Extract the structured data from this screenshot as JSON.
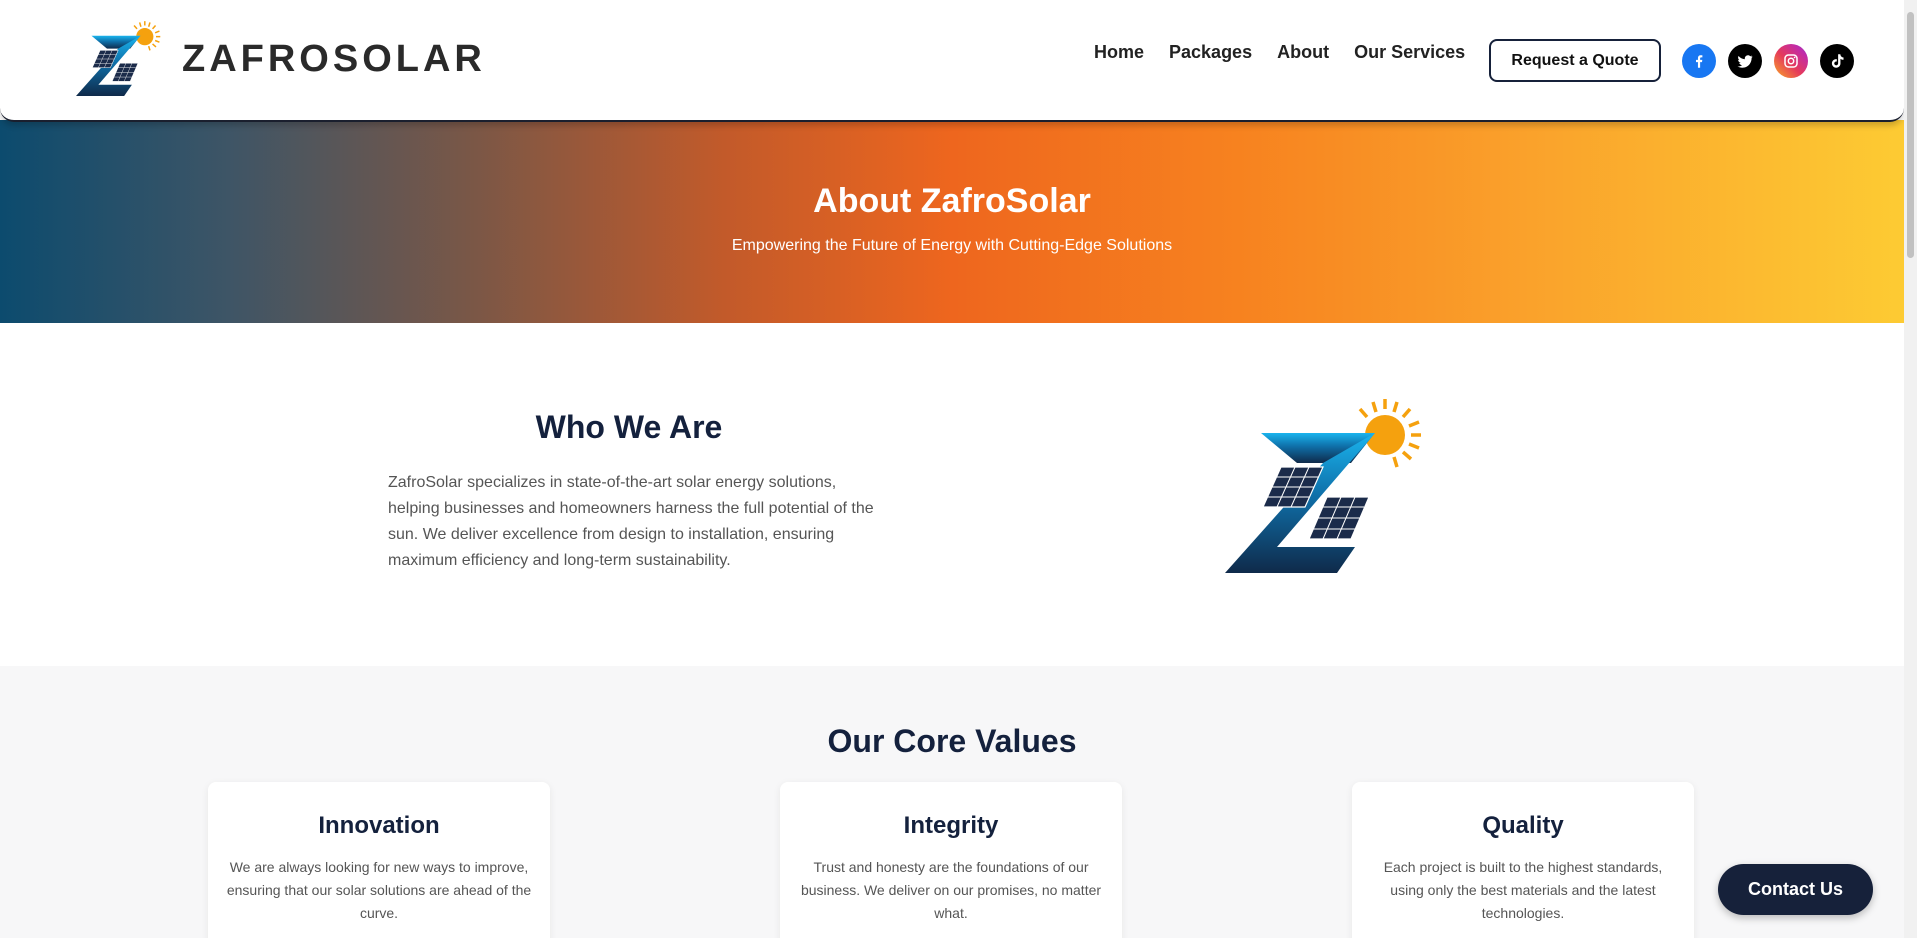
{
  "header": {
    "brand_name": "ZAFROSOLAR",
    "nav": [
      "Home",
      "Packages",
      "About",
      "Our Services"
    ],
    "quote_label": "Request a Quote",
    "socials": [
      "facebook-icon",
      "twitter-icon",
      "instagram-icon",
      "tiktok-icon"
    ]
  },
  "hero": {
    "title": "About ZafroSolar",
    "subtitle": "Empowering the Future of Energy with Cutting-Edge Solutions"
  },
  "who": {
    "title": "Who We Are",
    "body": "ZafroSolar specializes in state-of-the-art solar energy solutions, helping businesses and homeowners harness the full potential of the sun. We deliver excellence from design to installation, ensuring maximum efficiency and long-term sustainability."
  },
  "values": {
    "title": "Our Core Values",
    "cards": [
      {
        "title": "Innovation",
        "text": "We are always looking for new ways to improve, ensuring that our solar solutions are ahead of the curve."
      },
      {
        "title": "Integrity",
        "text": "Trust and honesty are the foundations of our business. We deliver on our promises, no matter what."
      },
      {
        "title": "Quality",
        "text": "Each project is built to the highest standards, using only the best materials and the latest technologies."
      }
    ]
  },
  "contact_label": "Contact Us",
  "colors": {
    "navy": "#14213d",
    "orange": "#ee661e",
    "yellow": "#fdcb33",
    "teal": "#0c4b6e"
  }
}
